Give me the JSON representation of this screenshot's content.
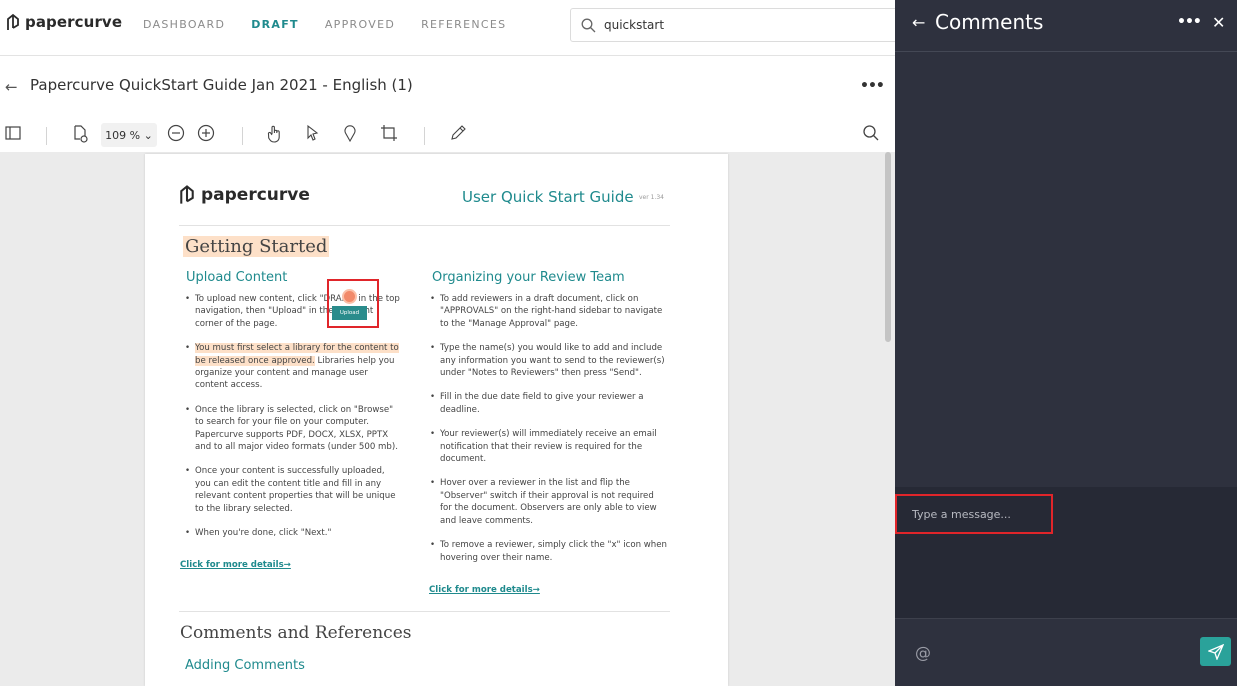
{
  "brand": {
    "name": "papercurve"
  },
  "nav": {
    "items": [
      {
        "label": "DASHBOARD",
        "active": false
      },
      {
        "label": "DRAFT",
        "active": true
      },
      {
        "label": "APPROVED",
        "active": false
      },
      {
        "label": "REFERENCES",
        "active": false
      }
    ]
  },
  "search": {
    "value": "quickstart"
  },
  "document": {
    "title": "Papercurve QuickStart Guide Jan 2021 - English (1)"
  },
  "toolbar": {
    "zoom": "109 % ⌄"
  },
  "page": {
    "logo": "papercurve",
    "guide_title": "User Quick Start Guide",
    "version": "ver 1.34",
    "getting_started": "Getting Started",
    "upload_heading": "Upload Content",
    "upload_btn_text": "Upload",
    "upload_items": [
      "To upload new content, click \"DRAFT\" in the top navigation, then \"Upload\" in the top right corner of the page.",
      "You must first select a library for the content to be released once approved.",
      "Libraries help you organize your content and manage user content access.",
      "Once the library is selected, click on \"Browse\" to search for your file on your computer. Papercurve supports PDF, DOCX, XLSX, PPTX and to all major video formats (under 500 mb).",
      "Once your content is successfully uploaded, you can edit the content title and fill in any relevant content properties that will be unique to the library selected.",
      "When you're done, click \"Next.\""
    ],
    "upload_more": "Click for more details→",
    "org_heading": "Organizing your Review Team",
    "org_items": [
      "To add reviewers in a draft document, click on \"APPROVALS\" on the right-hand sidebar to navigate to the \"Manage Approval\" page.",
      "Type the name(s) you would like to add and include any information you want to send to the reviewer(s) under \"Notes to Reviewers\" then press \"Send\".",
      "Fill in the due date field to give your reviewer a deadline.",
      "Your reviewer(s) will immediately receive an email notification that their review is required for the document.",
      "Hover over a reviewer in the list and flip the \"Observer\" switch if their approval is not required for the document. Observers are only able to view and leave comments.",
      "To remove a reviewer, simply click the \"x\" icon when hovering over their name."
    ],
    "org_more": "Click for more details→",
    "comments_refs": "Comments and References",
    "adding_comments": "Adding Comments"
  },
  "comments_panel": {
    "title": "Comments",
    "message_placeholder": "Type a message..."
  },
  "colors": {
    "accent": "#1f8a8d",
    "panel": "#2e313e",
    "highlight": "#fde0c8",
    "annotation": "#e0252a"
  }
}
